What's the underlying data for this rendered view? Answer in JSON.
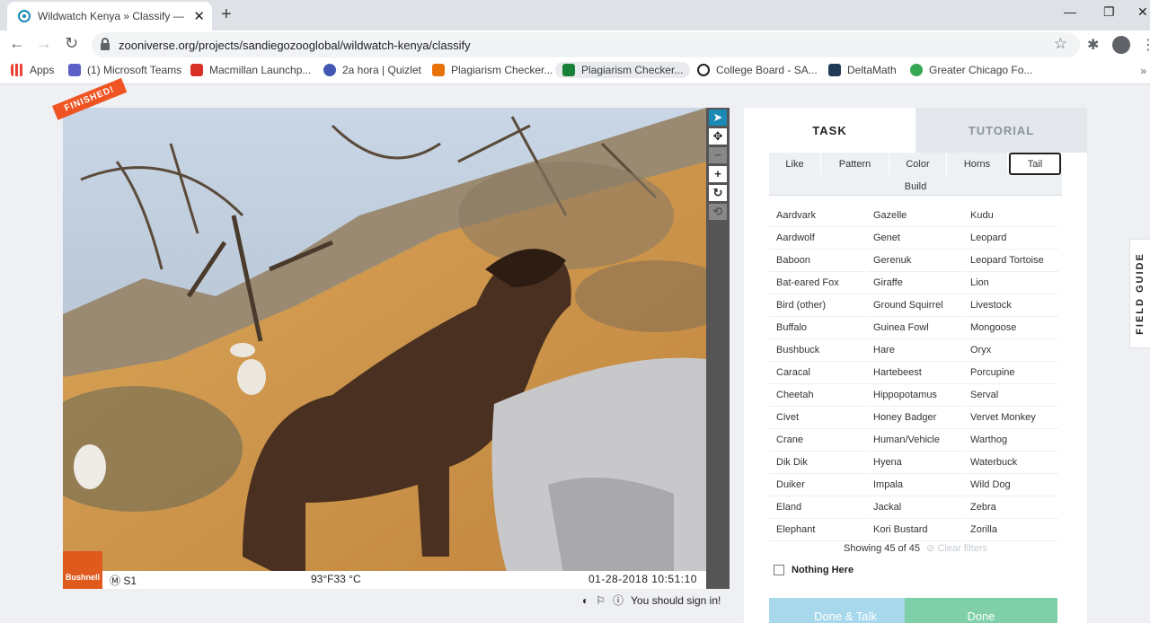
{
  "browser": {
    "tab_title": "Wildwatch Kenya » Classify — Zooniverse",
    "url": "zooniverse.org/projects/sandiegozooglobal/wildwatch-kenya/classify",
    "bookmarks": [
      "Apps",
      "(1) Microsoft Teams",
      "Macmillan Launchp...",
      "2a hora | Quizlet",
      "Plagiarism Checker...",
      "Plagiarism Checker...",
      "College Board - SA...",
      "DeltaMath",
      "Greater Chicago Fo..."
    ],
    "more": "»"
  },
  "viewer": {
    "banner": "FINISHED!",
    "camera_brand": "Bushnell",
    "camera_id": "S1",
    "temperature": "93°F33 °C",
    "timestamp": "01-28-2018 10:51:10",
    "sign_in": "You should sign in!"
  },
  "panel": {
    "tab_task": "TASK",
    "tab_tutorial": "TUTORIAL",
    "filters": [
      "Like",
      "Pattern",
      "Color",
      "Horns",
      "Tail",
      "Build"
    ],
    "selected_filter": "Tail",
    "species": [
      "Aardvark",
      "Gazelle",
      "Kudu",
      "Aardwolf",
      "Genet",
      "Leopard",
      "Baboon",
      "Gerenuk",
      "Leopard Tortoise",
      "Bat-eared Fox",
      "Giraffe",
      "Lion",
      "Bird (other)",
      "Ground Squirrel",
      "Livestock",
      "Buffalo",
      "Guinea Fowl",
      "Mongoose",
      "Bushbuck",
      "Hare",
      "Oryx",
      "Caracal",
      "Hartebeest",
      "Porcupine",
      "Cheetah",
      "Hippopotamus",
      "Serval",
      "Civet",
      "Honey Badger",
      "Vervet Monkey",
      "Crane",
      "Human/Vehicle",
      "Warthog",
      "Dik Dik",
      "Hyena",
      "Waterbuck",
      "Duiker",
      "Impala",
      "Wild Dog",
      "Eland",
      "Jackal",
      "Zebra",
      "Elephant",
      "Kori Bustard",
      "Zorilla"
    ],
    "showing": "Showing 45 of 45",
    "clear_filters": "Clear filters",
    "nothing_here": "Nothing Here",
    "done_talk": "Done & Talk",
    "done": "Done",
    "field_guide": "FIELD GUIDE"
  },
  "colors": {
    "accent": "#1a8ab5",
    "done_talk": "#a8d8ec",
    "done": "#7fcfa8",
    "banner": "#f05423"
  }
}
